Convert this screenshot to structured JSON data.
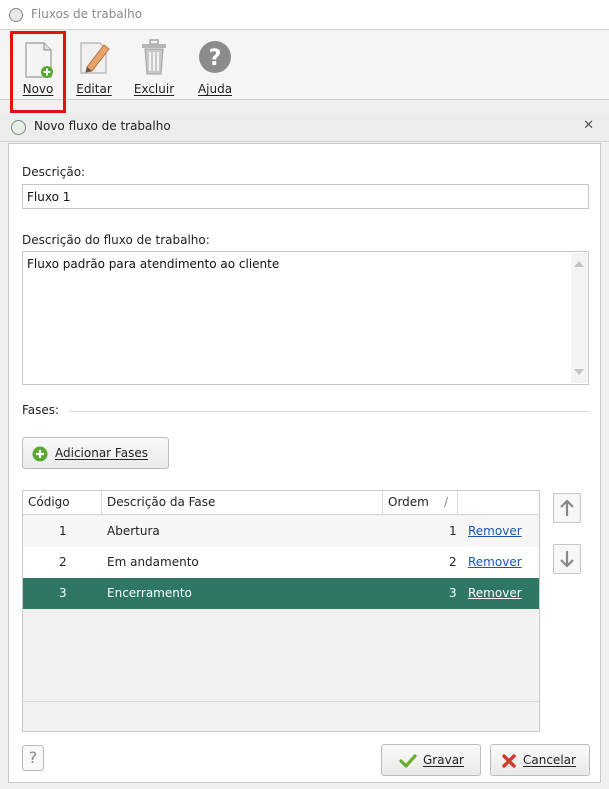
{
  "window": {
    "title": "Fluxos de trabalho"
  },
  "toolbar": {
    "new_label": "Novo",
    "edit_label": "Editar",
    "delete_label": "Excluir",
    "help_label": "Ajuda"
  },
  "panel": {
    "title": "Novo fluxo de trabalho",
    "close_glyph": "✕"
  },
  "form": {
    "descricao_label": "Descrição:",
    "descricao_value": "Fluxo 1",
    "fluxo_desc_label": "Descrição do fluxo de trabalho:",
    "fluxo_desc_value": "Fluxo padrão para atendimento ao cliente",
    "fases_label": "Fases:",
    "add_fases_label": "Adicionar Fases"
  },
  "grid": {
    "columns": [
      "Código",
      "Descrição da Fase",
      "Ordem"
    ],
    "sort_glyph": "/",
    "rows": [
      {
        "codigo": "1",
        "descricao": "Abertura",
        "ordem": "1",
        "action": "Remover",
        "selected": false
      },
      {
        "codigo": "2",
        "descricao": "Em andamento",
        "ordem": "2",
        "action": "Remover",
        "selected": false
      },
      {
        "codigo": "3",
        "descricao": "Encerramento",
        "ordem": "3",
        "action": "Remover",
        "selected": true
      }
    ]
  },
  "footer": {
    "help_glyph": "?",
    "save_label": "Gravar",
    "cancel_label": "Cancelar"
  },
  "colors": {
    "selection": "#2e7765",
    "highlight_border": "#e11414",
    "link": "#1a55b8",
    "add_green": "#5aa632",
    "cancel_red": "#d23a2a"
  },
  "icons": {
    "new": "new-document-icon",
    "edit": "edit-pencil-icon",
    "delete": "trash-icon",
    "help": "help-question-icon",
    "add": "plus-circle-icon",
    "up": "arrow-up-icon",
    "down": "arrow-down-icon",
    "save": "checkmark-icon",
    "cancel": "x-icon"
  }
}
